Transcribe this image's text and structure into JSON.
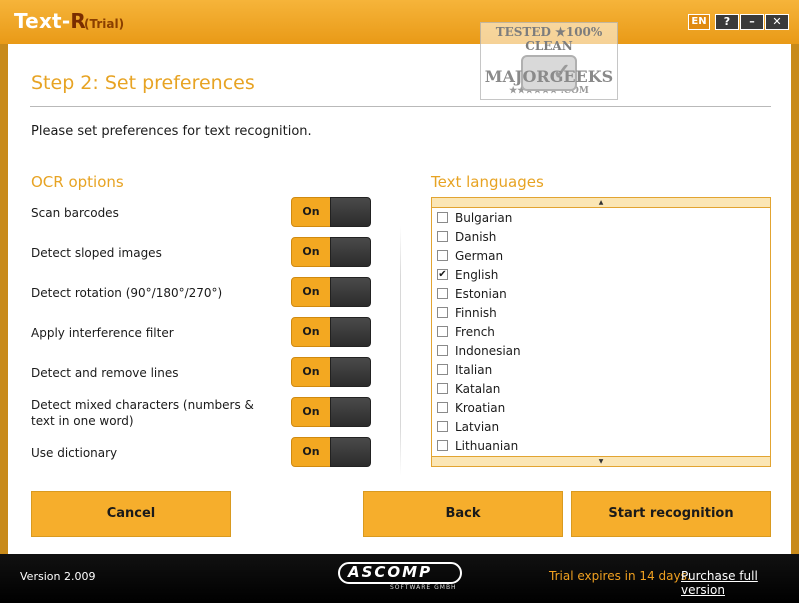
{
  "titlebar": {
    "app_name_main": "Text",
    "app_name_dash": "-",
    "app_name_r": "R",
    "trial_badge": "(Trial)",
    "lang_code": "EN",
    "help_label": "?",
    "minimize_label": "–",
    "close_label": "✕"
  },
  "watermark": {
    "line1": "TESTED ★100% CLEAN",
    "brand": "MAJORGEEKS",
    "domain": "★★★★★★ .COM"
  },
  "step": {
    "title": "Step 2: Set preferences",
    "intro": "Please set preferences for text recognition."
  },
  "ocr": {
    "title": "OCR options",
    "options": [
      {
        "label": "Scan barcodes",
        "state": "On"
      },
      {
        "label": "Detect sloped images",
        "state": "On"
      },
      {
        "label": "Detect rotation (90°/180°/270°)",
        "state": "On"
      },
      {
        "label": "Apply interference filter",
        "state": "On"
      },
      {
        "label": "Detect and remove lines",
        "state": "On"
      },
      {
        "label": "Detect mixed characters (numbers & text in one word)",
        "state": "On"
      },
      {
        "label": "Use dictionary",
        "state": "On"
      }
    ]
  },
  "languages": {
    "title": "Text languages",
    "scroll_up": "▲",
    "scroll_down": "▼",
    "items": [
      {
        "name": "Bulgarian",
        "checked": false
      },
      {
        "name": "Danish",
        "checked": false
      },
      {
        "name": "German",
        "checked": false
      },
      {
        "name": "English",
        "checked": true
      },
      {
        "name": "Estonian",
        "checked": false
      },
      {
        "name": "Finnish",
        "checked": false
      },
      {
        "name": "French",
        "checked": false
      },
      {
        "name": "Indonesian",
        "checked": false
      },
      {
        "name": "Italian",
        "checked": false
      },
      {
        "name": "Katalan",
        "checked": false
      },
      {
        "name": "Kroatian",
        "checked": false
      },
      {
        "name": "Latvian",
        "checked": false
      },
      {
        "name": "Lithuanian",
        "checked": false
      }
    ]
  },
  "buttons": {
    "cancel": "Cancel",
    "back": "Back",
    "start": "Start recognition"
  },
  "footer": {
    "version": "Version 2.009",
    "logo_text": "ASCOMP",
    "logo_sub": "SOFTWARE GMBH",
    "trial_text": "Trial expires in 14 days.",
    "purchase": "Purchase full version"
  },
  "colors": {
    "accent": "#f3a821",
    "title_orange": "#e7a323",
    "footer_bg": "#000000"
  }
}
